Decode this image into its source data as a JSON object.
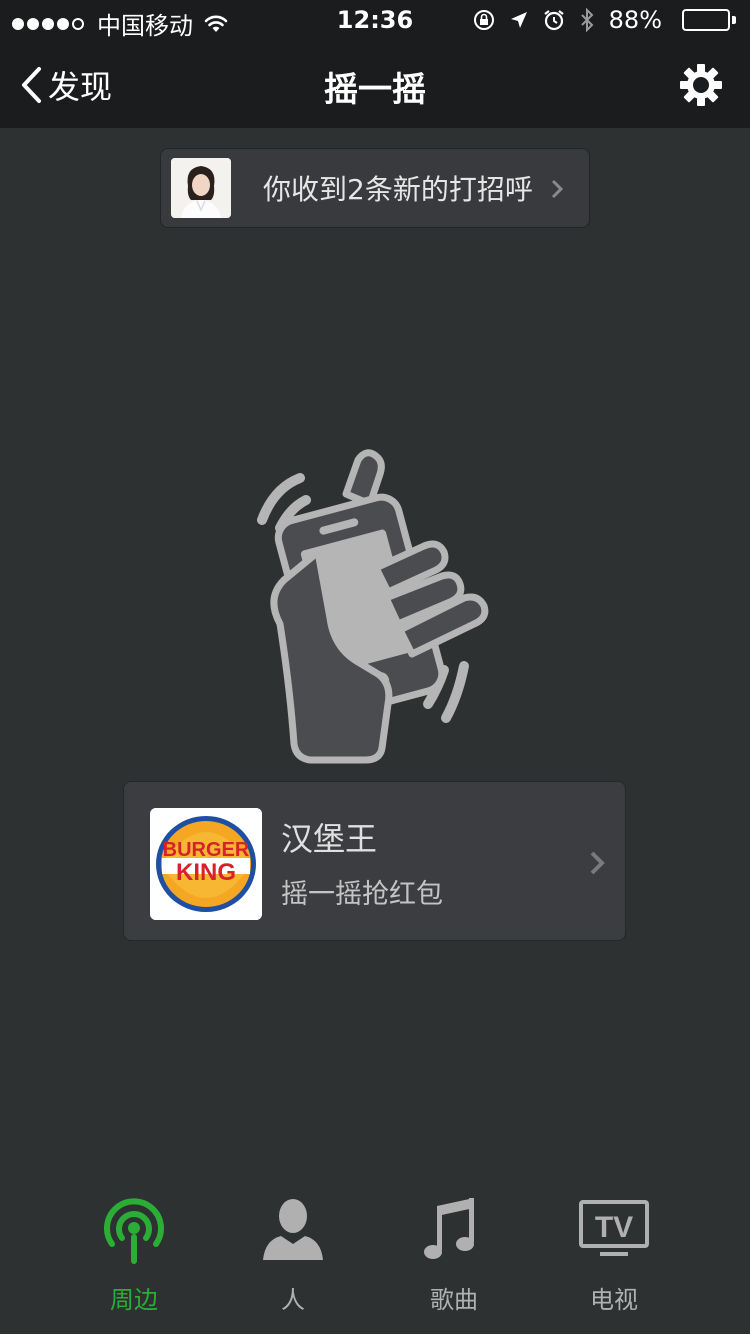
{
  "status_bar": {
    "carrier": "中国移动",
    "time": "12:36",
    "battery_percent": "88%",
    "battery_level": 0.88,
    "signal_bars_filled": 4,
    "signal_bars_total": 5
  },
  "nav": {
    "back_label": "发现",
    "title": "摇一摇"
  },
  "greeting": {
    "text": "你收到2条新的打招呼"
  },
  "result": {
    "logo_line1": "BURGER",
    "logo_line2": "KING",
    "title": "汉堡王",
    "subtitle": "摇一摇抢红包"
  },
  "tabs": [
    {
      "label": "周边",
      "icon": "radar-icon",
      "active": true
    },
    {
      "label": "人",
      "icon": "person-icon",
      "active": false
    },
    {
      "label": "歌曲",
      "icon": "music-note-icon",
      "active": false
    },
    {
      "label": "电视",
      "icon": "tv-icon",
      "active": false
    }
  ],
  "colors": {
    "background": "#2e3132",
    "bar": "#1b1c1e",
    "accent_green": "#2aae36",
    "inactive_gray": "#b0b0b0"
  }
}
